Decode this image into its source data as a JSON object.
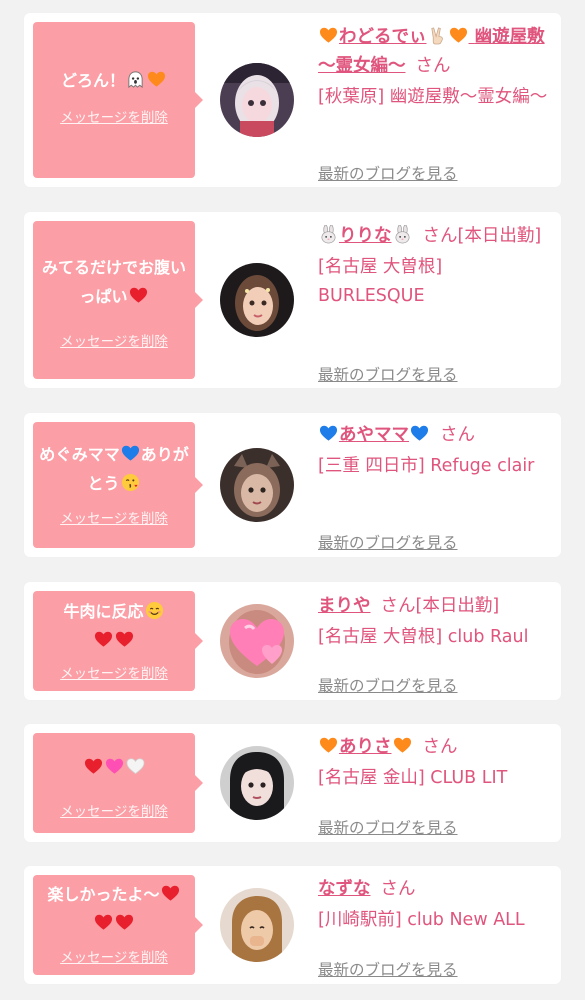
{
  "theme": {
    "accent_pink": "#fc9ea5",
    "name_pink": "#e0557d",
    "link_gray": "#8a8a8a",
    "card_bg": "#ffffff",
    "page_bg": "#f2f2f2"
  },
  "delete_label": "メッセージを削除",
  "blog_label": "最新のブログを見る",
  "honorific": "さん",
  "cards": [
    {
      "message": "どろん！",
      "message_emoji": [
        "ghost-emoji",
        "orange-heart-emoji"
      ],
      "name_prefix_emoji": "orange-heart-emoji",
      "name": "わどるでぃ",
      "name_suffix_emoji": [
        "victory-hand-emoji",
        "orange-heart-emoji"
      ],
      "name_extra": "幽遊屋敷 〜霊女編〜",
      "status": "",
      "shop": "[秋葉原] 幽遊屋敷〜霊女編〜",
      "avatar": "avatar-photo-1"
    },
    {
      "message": "みてるだけでお腹いっぱい",
      "message_emoji": [
        "red-heart-emoji"
      ],
      "name_prefix_emoji": "rabbit-emoji",
      "name": "りりな",
      "name_suffix_emoji": [
        "rabbit-emoji"
      ],
      "status": "[本日出勤]",
      "shop": "[名古屋 大曽根] BURLESQUE",
      "avatar": "avatar-photo-2"
    },
    {
      "message": "めぐみママ",
      "message_emoji": [
        "blue-heart-emoji",
        "kissing-face-emoji"
      ],
      "message_after": "ありがとう",
      "name_prefix_emoji": "blue-heart-emoji",
      "name": "あやママ",
      "name_suffix_emoji": [
        "blue-heart-emoji"
      ],
      "status": "",
      "shop": "[三重 四日市] Refuge clair",
      "avatar": "avatar-photo-3"
    },
    {
      "message": "牛肉に反応",
      "message_emoji": [
        "smiling-face-emoji",
        "red-heart-emoji",
        "red-heart-emoji"
      ],
      "name_prefix_emoji": "",
      "name": "まりや",
      "name_suffix_emoji": [],
      "status": "[本日出勤]",
      "shop": "[名古屋 大曽根] club Raul",
      "avatar": "avatar-photo-4"
    },
    {
      "message": "",
      "message_emoji": [
        "red-heart-emoji",
        "pink-heart-emoji",
        "white-heart-emoji"
      ],
      "name_prefix_emoji": "orange-heart-emoji",
      "name": "ありさ",
      "name_suffix_emoji": [
        "orange-heart-emoji"
      ],
      "status": "",
      "shop": "[名古屋 金山] CLUB LIT",
      "avatar": "avatar-photo-5"
    },
    {
      "message": "楽しかったよ〜",
      "message_emoji": [
        "red-heart-emoji",
        "red-heart-emoji",
        "red-heart-emoji"
      ],
      "name_prefix_emoji": "",
      "name": "なずな",
      "name_suffix_emoji": [],
      "status": "",
      "shop": "[川崎駅前] club New ALL",
      "avatar": "avatar-photo-6"
    }
  ]
}
